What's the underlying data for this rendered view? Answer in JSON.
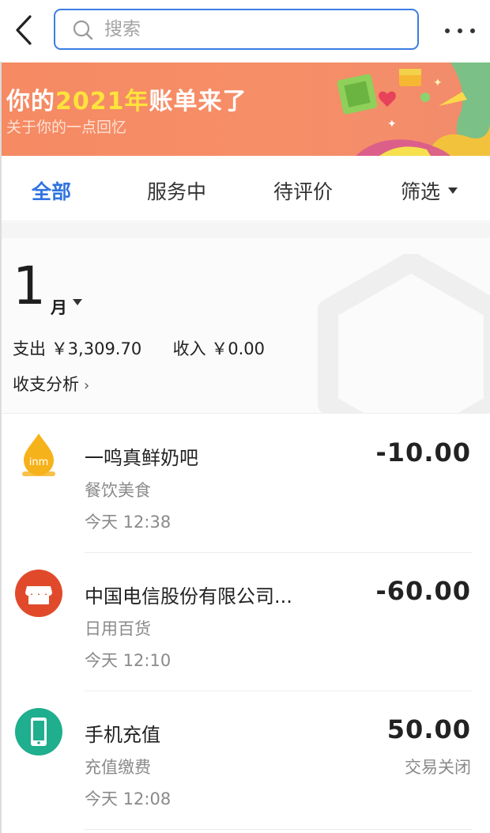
{
  "header": {
    "search_placeholder": "搜索"
  },
  "banner": {
    "title_prefix": "你的",
    "title_highlight": "2021年",
    "title_suffix": "账单来了",
    "subtitle": "关于你的一点回忆",
    "colors": {
      "background": "#f68b65",
      "highlight": "#ffe33b"
    }
  },
  "tabs": [
    {
      "label": "全部",
      "active": true
    },
    {
      "label": "服务中",
      "active": false
    },
    {
      "label": "待评价",
      "active": false
    },
    {
      "label": "筛选",
      "active": false,
      "has_dropdown": true
    }
  ],
  "summary": {
    "month_number": "1",
    "month_label": "月",
    "expense_label": "支出",
    "expense_value": "￥3,309.70",
    "income_label": "收入",
    "income_value": "￥0.00",
    "analysis_label": "收支分析",
    "analysis_chevron": "›"
  },
  "transactions": [
    {
      "icon": "milk-bar-logo-icon",
      "logo_text": "inm",
      "name": "一鸣真鲜奶吧",
      "category": "餐饮美食",
      "time": "今天  12:38",
      "amount": "-10.00",
      "status": ""
    },
    {
      "icon": "store-icon",
      "name": "中国电信股份有限公司...",
      "category": "日用百货",
      "time": "今天  12:10",
      "amount": "-60.00",
      "status": ""
    },
    {
      "icon": "mobile-phone-icon",
      "name": "手机充值",
      "category": "充值缴费",
      "time": "今天  12:08",
      "amount": "50.00",
      "status": "交易关闭"
    }
  ],
  "colors": {
    "accent": "#2f73e0",
    "store_icon": "#e04a2b",
    "phone_icon": "#1fae8e",
    "milk_icon": "#f6b21b"
  }
}
